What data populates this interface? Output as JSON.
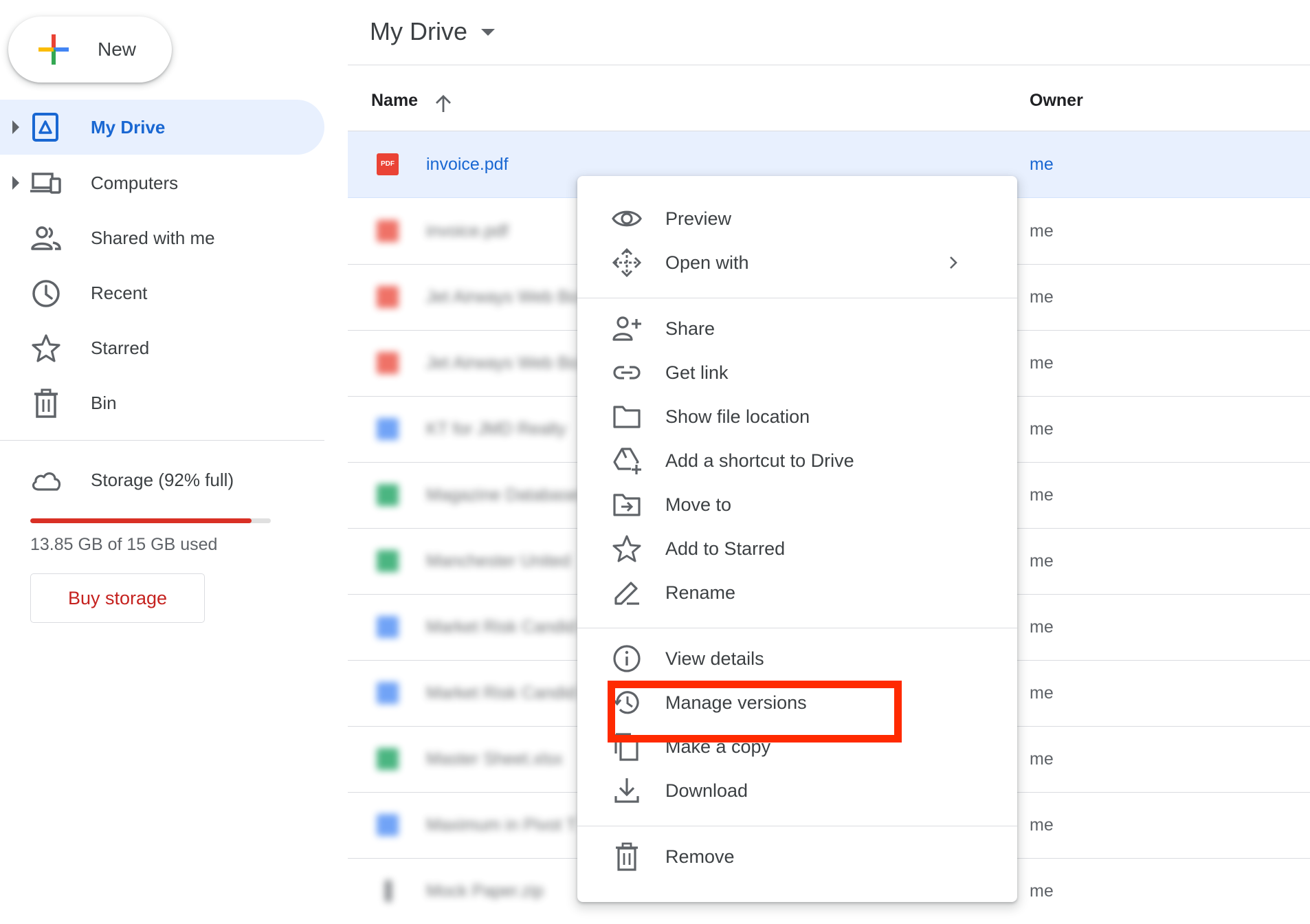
{
  "sidebar": {
    "new_label": "New",
    "items": [
      {
        "id": "my-drive",
        "label": "My Drive",
        "icon": "drive-icon",
        "active": true
      },
      {
        "id": "computers",
        "label": "Computers",
        "icon": "computers-icon"
      },
      {
        "id": "shared",
        "label": "Shared with me",
        "icon": "people-icon"
      },
      {
        "id": "recent",
        "label": "Recent",
        "icon": "clock-icon"
      },
      {
        "id": "starred",
        "label": "Starred",
        "icon": "star-icon"
      },
      {
        "id": "bin",
        "label": "Bin",
        "icon": "trash-icon"
      }
    ],
    "storage": {
      "label": "Storage (92% full)",
      "used_text": "13.85 GB of 15 GB used",
      "percent": 92,
      "buy_label": "Buy storage"
    }
  },
  "main": {
    "title": "My Drive",
    "columns": {
      "name": "Name",
      "owner": "Owner"
    },
    "files": [
      {
        "name": "invoice.pdf",
        "type": "pdf",
        "owner": "me",
        "selected": true
      },
      {
        "name": "invoice.pdf",
        "type": "pdf",
        "owner": "me",
        "blurred": true
      },
      {
        "name": "Jet Airways Web Bo",
        "type": "pdf",
        "owner": "me",
        "blurred": true
      },
      {
        "name": "Jet Airways Web Bo",
        "type": "pdf",
        "owner": "me",
        "blurred": true
      },
      {
        "name": "KT for JMD Realty",
        "type": "doc",
        "owner": "me",
        "blurred": true
      },
      {
        "name": "Magazine Database",
        "type": "sheet",
        "owner": "me",
        "blurred": true
      },
      {
        "name": "Manchester United",
        "type": "sheet",
        "owner": "me",
        "blurred": true
      },
      {
        "name": "Market Risk Candid",
        "type": "doc",
        "owner": "me",
        "blurred": true
      },
      {
        "name": "Market Risk Candid",
        "type": "doc",
        "owner": "me",
        "blurred": true
      },
      {
        "name": "Master Sheet.xlsx",
        "type": "sheet",
        "owner": "me",
        "blurred": true
      },
      {
        "name": "Maximum in Pivot T",
        "type": "doc",
        "owner": "me",
        "blurred": true
      },
      {
        "name": "Mock Paper.zip",
        "type": "zip",
        "owner": "me",
        "blurred": true
      }
    ]
  },
  "context_menu": {
    "items": [
      {
        "id": "preview",
        "label": "Preview",
        "icon": "eye-icon"
      },
      {
        "id": "open-with",
        "label": "Open with",
        "icon": "move-arrows-icon",
        "submenu": true
      },
      {
        "id": "share",
        "label": "Share",
        "icon": "person-add-icon"
      },
      {
        "id": "get-link",
        "label": "Get link",
        "icon": "link-icon"
      },
      {
        "id": "show-location",
        "label": "Show file location",
        "icon": "folder-icon"
      },
      {
        "id": "add-shortcut",
        "label": "Add a shortcut to Drive",
        "icon": "drive-shortcut-icon"
      },
      {
        "id": "move-to",
        "label": "Move to",
        "icon": "folder-move-icon"
      },
      {
        "id": "add-starred",
        "label": "Add to Starred",
        "icon": "star-icon"
      },
      {
        "id": "rename",
        "label": "Rename",
        "icon": "pencil-icon"
      },
      {
        "id": "view-details",
        "label": "View details",
        "icon": "info-icon"
      },
      {
        "id": "manage-versions",
        "label": "Manage versions",
        "icon": "history-icon",
        "highlighted": true
      },
      {
        "id": "make-copy",
        "label": "Make a copy",
        "icon": "copy-icon"
      },
      {
        "id": "download",
        "label": "Download",
        "icon": "download-icon"
      },
      {
        "id": "remove",
        "label": "Remove",
        "icon": "trash-icon"
      }
    ]
  },
  "colors": {
    "accent": "#1967d2",
    "selected_bg": "#e8f0fe",
    "highlight": "#ff2a00",
    "storage_fill": "#d93025"
  }
}
